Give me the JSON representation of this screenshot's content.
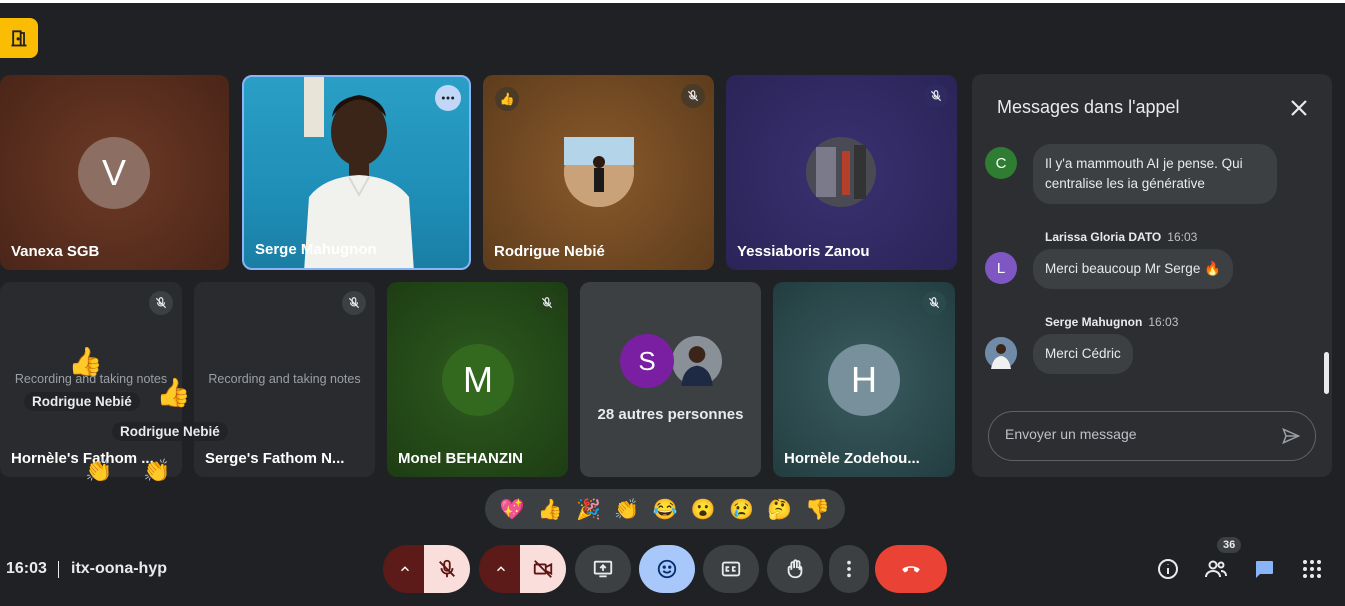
{
  "header": {
    "door_icon": "door-exit-icon",
    "accent": "#fbbc04"
  },
  "tiles": [
    {
      "name": "Vanexa SGB",
      "initial": "V",
      "avatar_color": "#8d6e63"
    },
    {
      "name": "Serge Mahugnon"
    },
    {
      "name": "Rodrigue Nebié",
      "reaction": "👍"
    },
    {
      "name": "Yessiaboris Zanou"
    },
    {
      "name": "Hornèle's Fathom ...",
      "notes": "Recording and taking notes"
    },
    {
      "name": "Serge's Fathom N...",
      "notes": "Recording and taking notes"
    },
    {
      "name": "Monel BEHANZIN",
      "initial": "M",
      "avatar_color": "#33691e"
    },
    {
      "name": "28 autres personnes",
      "initial": "S",
      "avatar_color": "#7b1fa2"
    },
    {
      "name": "Hornèle Zodehou...",
      "initial": "H",
      "avatar_color": "#78909c"
    }
  ],
  "floating": {
    "name1": "Rodrigue Nebié",
    "name2": "Rodrigue Nebié",
    "emoji": "👍",
    "emoji_clap": "👏"
  },
  "chat": {
    "title": "Messages dans l'appel",
    "messages": [
      {
        "avatar": "C",
        "avatar_color": "#2e7d32",
        "line1": "Il y'a mammouth AI je pense. Qui",
        "line2": "centralise les ia générative"
      },
      {
        "sender": "Larissa Gloria DATO",
        "time": "16:03",
        "avatar": "L",
        "avatar_color": "#7e57c2",
        "text": "Merci beaucoup Mr Serge 🔥"
      },
      {
        "sender": "Serge Mahugnon",
        "time": "16:03",
        "text": "Merci Cédric"
      }
    ],
    "input_placeholder": "Envoyer un message"
  },
  "reactions": [
    "💖",
    "👍",
    "🎉",
    "👏",
    "😂",
    "😮",
    "😢",
    "🤔",
    "👎"
  ],
  "footer": {
    "time": "16:03",
    "meeting_code": "itx-oona-hyp",
    "people_count": "36"
  },
  "colors": {
    "background": "#202124",
    "leave": "#ea4335",
    "active_control": "#a8c7fa",
    "muted_control": "#f9dedc"
  }
}
